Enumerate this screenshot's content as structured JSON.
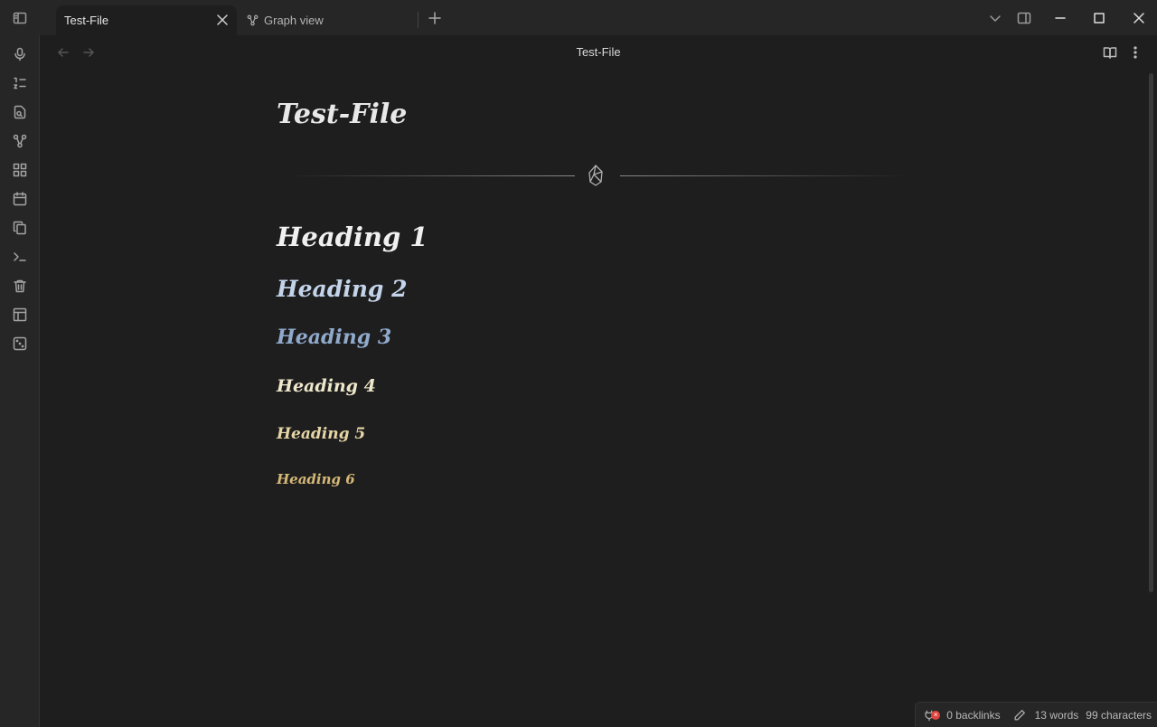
{
  "tabs": [
    {
      "label": "Test-File"
    },
    {
      "label": "Graph view"
    }
  ],
  "view": {
    "title": "Test-File"
  },
  "note": {
    "inline_title": "Test-File",
    "headings": [
      "Heading 1",
      "Heading 2",
      "Heading 3",
      "Heading 4",
      "Heading 5",
      "Heading 6"
    ]
  },
  "ribbon_icons": [
    "microphone-icon",
    "outline-icon",
    "file-search-icon",
    "graph-icon",
    "canvas-grid-icon",
    "calendar-icon",
    "copy-files-icon",
    "terminal-icon",
    "trash-icon",
    "layout-icon",
    "dice-icon"
  ],
  "status": {
    "backlinks": "0 backlinks",
    "words": "13 words",
    "characters": "99 characters"
  },
  "colors": {
    "h1": "#f0f0f0",
    "h2": "#c3d3ea",
    "h3": "#90aacc",
    "h4": "#f0e8cc",
    "h5": "#e6d6a6",
    "h6": "#d6b978",
    "error_badge": "#e0443e"
  }
}
